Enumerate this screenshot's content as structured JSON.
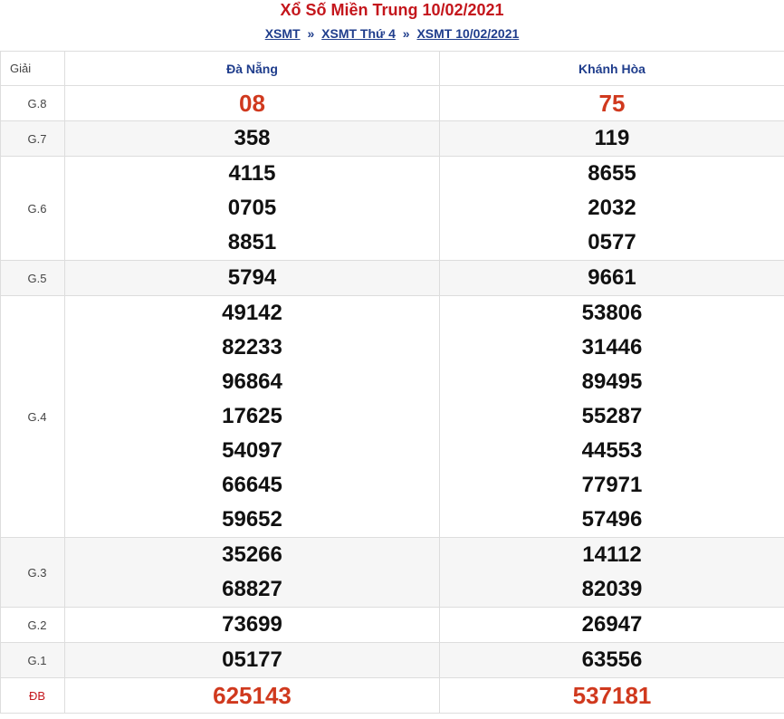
{
  "header": {
    "title": "Xổ Số Miền Trung 10/02/2021",
    "breadcrumb": [
      "XSMT",
      "XSMT Thứ 4",
      "XSMT 10/02/2021"
    ],
    "separator": "»"
  },
  "table": {
    "label_header": "Giải",
    "provinces": [
      "Đà Nẵng",
      "Khánh Hòa"
    ],
    "prizes": [
      {
        "label": "G.8",
        "da_nang": [
          "08"
        ],
        "khanh_hoa": [
          "75"
        ]
      },
      {
        "label": "G.7",
        "da_nang": [
          "358"
        ],
        "khanh_hoa": [
          "119"
        ]
      },
      {
        "label": "G.6",
        "da_nang": [
          "4115",
          "0705",
          "8851"
        ],
        "khanh_hoa": [
          "8655",
          "2032",
          "0577"
        ]
      },
      {
        "label": "G.5",
        "da_nang": [
          "5794"
        ],
        "khanh_hoa": [
          "9661"
        ]
      },
      {
        "label": "G.4",
        "da_nang": [
          "49142",
          "82233",
          "96864",
          "17625",
          "54097",
          "66645",
          "59652"
        ],
        "khanh_hoa": [
          "53806",
          "31446",
          "89495",
          "55287",
          "44553",
          "77971",
          "57496"
        ]
      },
      {
        "label": "G.3",
        "da_nang": [
          "35266",
          "68827"
        ],
        "khanh_hoa": [
          "14112",
          "82039"
        ]
      },
      {
        "label": "G.2",
        "da_nang": [
          "73699"
        ],
        "khanh_hoa": [
          "26947"
        ]
      },
      {
        "label": "G.1",
        "da_nang": [
          "05177"
        ],
        "khanh_hoa": [
          "63556"
        ]
      },
      {
        "label": "ĐB",
        "da_nang": [
          "625143"
        ],
        "khanh_hoa": [
          "537181"
        ]
      }
    ]
  },
  "colors": {
    "title": "#c4161c",
    "link": "#1f3d8c",
    "highlight_number": "#d0391e",
    "row_alt": "#f6f6f6"
  }
}
